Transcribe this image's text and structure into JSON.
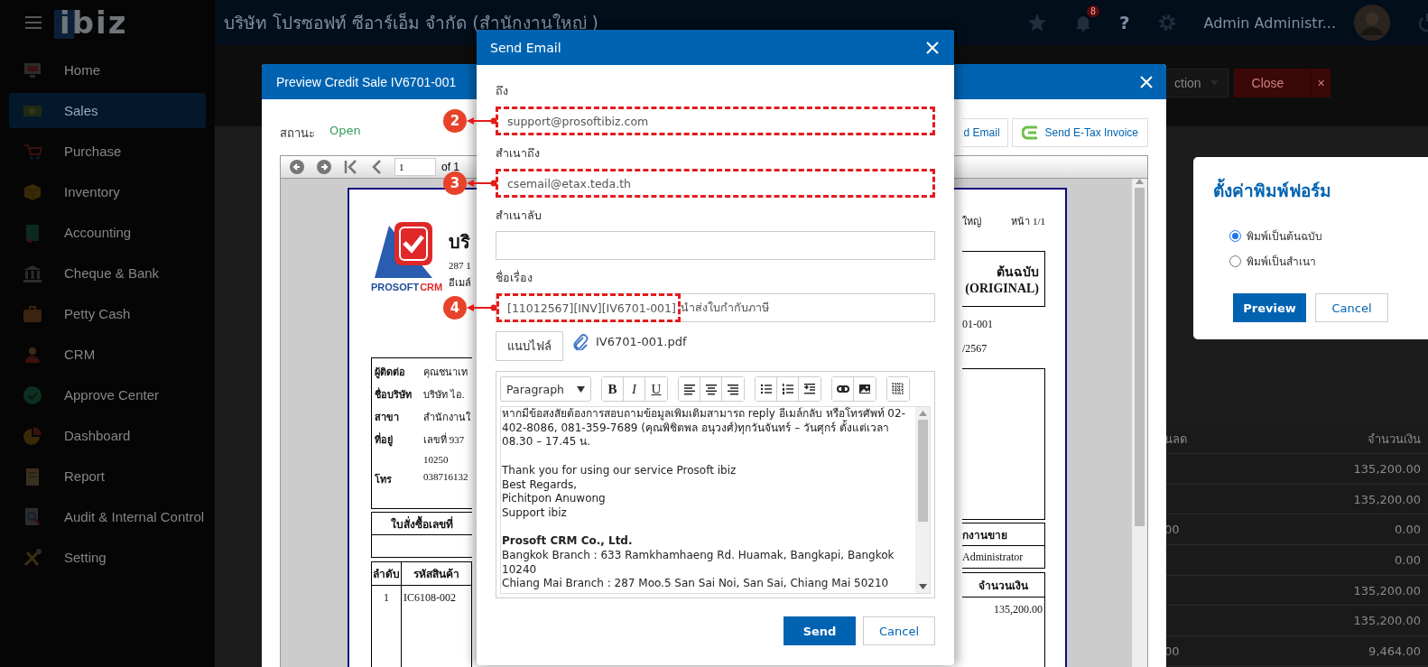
{
  "topbar": {
    "logo": "ibiz",
    "company": "บริษัท โปรซอฟท์ ซีอาร์เอ็ม จำกัด (สำนักงานใหญ่ )",
    "notification_count": "8",
    "help": "?",
    "user_name": "Admin Administr..."
  },
  "sidebar": {
    "items": [
      {
        "label": "Home",
        "selected": false
      },
      {
        "label": "Sales",
        "selected": true
      },
      {
        "label": "Purchase",
        "selected": false
      },
      {
        "label": "Inventory",
        "selected": false
      },
      {
        "label": "Accounting",
        "selected": false
      },
      {
        "label": "Cheque & Bank",
        "selected": false
      },
      {
        "label": "Petty Cash",
        "selected": false
      },
      {
        "label": "CRM",
        "selected": false
      },
      {
        "label": "Approve Center",
        "selected": false
      },
      {
        "label": "Dashboard",
        "selected": false
      },
      {
        "label": "Report",
        "selected": false
      },
      {
        "label": "Audit & Internal Control",
        "selected": false
      },
      {
        "label": "Setting",
        "selected": false
      }
    ]
  },
  "page_actions": {
    "action_button": "ction",
    "close_button": "Close",
    "close_x": "×"
  },
  "background_table": {
    "columns": [
      "นลด",
      "จำนวนเงิน"
    ],
    "rows": [
      {
        "amount": "135,200.00"
      },
      {
        "amount": "135,200.00"
      },
      {
        "column_1": "00",
        "amount": "0.00"
      },
      {
        "amount": "0.00"
      },
      {
        "amount": "135,200.00"
      },
      {
        "amount": "135,200.00"
      },
      {
        "column_1": "00",
        "amount": "9,464.00"
      }
    ]
  },
  "preview": {
    "title": "Preview Credit Sale IV6701-001",
    "status_label": "สถานะ",
    "status": "Open",
    "buttons": [
      "d Email",
      "Send E-Tax Invoice"
    ],
    "viewer": {
      "page": "1",
      "page_count": "of 1"
    },
    "document": {
      "logo_words": [
        "PROSOFT",
        "CRM"
      ],
      "company": "บริ",
      "address": "287 1",
      "email": "อีเมล์",
      "branch_note": "ใหญ่",
      "page_no": "หน้า 1/1",
      "copy_title": "ต้นฉบับ",
      "copy_subtitle": "(ORIGINAL)",
      "doc_no": "01-001",
      "doc_date": "/2567",
      "contact": [
        {
          "label": "ผู้ติดต่อ",
          "value": "คุณชนาเท"
        },
        {
          "label": "ชื่อบริษัท",
          "value": "บริษัท ไอ."
        },
        {
          "label": "สาขา",
          "value": "สำนักงานใ"
        },
        {
          "label": "ที่อยู่",
          "value": "เลขที่ 937"
        },
        {
          "value": "10250"
        },
        {
          "label": "โทร",
          "value": "038716132"
        }
      ],
      "order_table": {
        "column_1": "ใบสั่งซื้อเลขที่",
        "column_last": "กงานขาย",
        "value_last": "Administrator"
      },
      "items_table": {
        "columns": [
          "ลำดับ",
          "รหัสสินค้า"
        ],
        "amount_column": "จำนวนเงิน",
        "rows": [
          {
            "no": "1",
            "code": "IC6108-002",
            "amount": "135,200.00"
          }
        ]
      }
    }
  },
  "email": {
    "title": "Send Email",
    "fields": [
      {
        "label": "ถึง",
        "value": "support@prosoftibiz.com",
        "highlighted": true,
        "marker": "2"
      },
      {
        "label": "สำเนาถึง",
        "value": "csemail@etax.teda.th",
        "highlighted": true,
        "marker": "3"
      },
      {
        "label": "สำเนาลับ",
        "highlighted": false
      },
      {
        "label": "ชื่อเรื่อง",
        "segments": [
          {
            "text": "[11012567][INV][IV6701-001]",
            "highlighted": true
          },
          {
            "text": "นำส่งใบกำกับภาษี",
            "highlighted": false
          }
        ],
        "marker": "4"
      }
    ],
    "attach_button": "แนบไฟล์",
    "attachment": "IV6701-001.pdf",
    "editor": {
      "format": "Paragraph",
      "style_buttons": [
        "B",
        "I",
        "U"
      ],
      "body": [
        {
          "lines": [
            {
              "text": "หากมีข้อสงสัยต้องการสอบถามข้อมูลเพิ่มเติมสามารถ reply อีเมล์กลับ หรือโทรศัพท์ 02-402-8086, 081-359-7689 (คุณพิชิตพล อนุวงศ์)ทุกวันจันทร์ – วันศุกร์ ตั้งแต่เวลา 08.30 – 17.45 น.",
              "bold": false
            }
          ]
        },
        {
          "lines": [
            {
              "text": "Thank you for using our service Prosoft ibiz",
              "bold": false
            },
            {
              "text": "Best Regards,",
              "bold": false
            },
            {
              "text": "Pichitpon Anuwong",
              "bold": false
            },
            {
              "text": "Support ibiz",
              "bold": false
            }
          ]
        },
        {
          "lines": [
            {
              "text": "Prosoft CRM Co., Ltd.",
              "bold": true
            },
            {
              "text": "Bangkok Branch : 633 Ramkhamhaeng Rd. Huamak, Bangkapi, Bangkok 10240",
              "bold": false
            },
            {
              "text": "Chiang Mai Branch : 287 Moo.5 San Sai Noi, San Sai, Chiang Mai 50210",
              "bold": false
            }
          ]
        }
      ]
    },
    "buttons": [
      {
        "label": "Send",
        "primary": true
      },
      {
        "label": "Cancel",
        "primary": false
      }
    ]
  },
  "print_popup": {
    "title": "ตั้งค่าพิมพ์ฟอร์ม",
    "options": [
      {
        "label": "พิมพ์เป็นต้นฉบับ",
        "selected": true
      },
      {
        "label": "พิมพ์เป็นสำเนา",
        "selected": false
      }
    ],
    "buttons": [
      {
        "label": "Preview",
        "primary": true
      },
      {
        "label": "Cancel",
        "primary": false
      }
    ]
  }
}
